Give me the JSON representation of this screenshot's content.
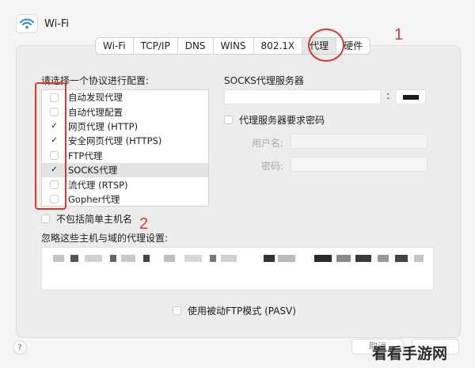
{
  "header": {
    "title": "Wi-Fi",
    "icon": "wifi-icon"
  },
  "tabs": [
    {
      "label": "Wi-Fi",
      "active": false
    },
    {
      "label": "TCP/IP",
      "active": false
    },
    {
      "label": "DNS",
      "active": false
    },
    {
      "label": "WINS",
      "active": false
    },
    {
      "label": "802.1X",
      "active": false
    },
    {
      "label": "代理",
      "active": true
    },
    {
      "label": "硬件",
      "active": false
    }
  ],
  "annotations": {
    "one": "1",
    "two": "2",
    "color": "#d63a2f"
  },
  "protocols": {
    "heading": "请选择一个协议进行配置:",
    "items": [
      {
        "label": "自动发现代理",
        "checked": false,
        "selected": false
      },
      {
        "label": "自动代理配置",
        "checked": false,
        "selected": false
      },
      {
        "label": "网页代理 (HTTP)",
        "checked": true,
        "selected": false
      },
      {
        "label": "安全网页代理 (HTTPS)",
        "checked": true,
        "selected": false
      },
      {
        "label": "FTP代理",
        "checked": false,
        "selected": false
      },
      {
        "label": "SOCKS代理",
        "checked": true,
        "selected": true
      },
      {
        "label": "流代理 (RTSP)",
        "checked": false,
        "selected": false
      },
      {
        "label": "Gopher代理",
        "checked": false,
        "selected": false
      }
    ]
  },
  "socks": {
    "server_label": "SOCKS代理服务器",
    "colon": ":",
    "password_required_label": "代理服务器要求密码",
    "username_label": "用户名:",
    "password_label": "密码:"
  },
  "exclude_simple_hostnames": "不包括简单主机名",
  "bypass_label": "忽略这些主机与域的代理设置:",
  "pasv_label": "使用被动FTP模式 (PASV)",
  "footer": {
    "help": "?",
    "cancel": "取消",
    "watermark": "看看手游网"
  }
}
